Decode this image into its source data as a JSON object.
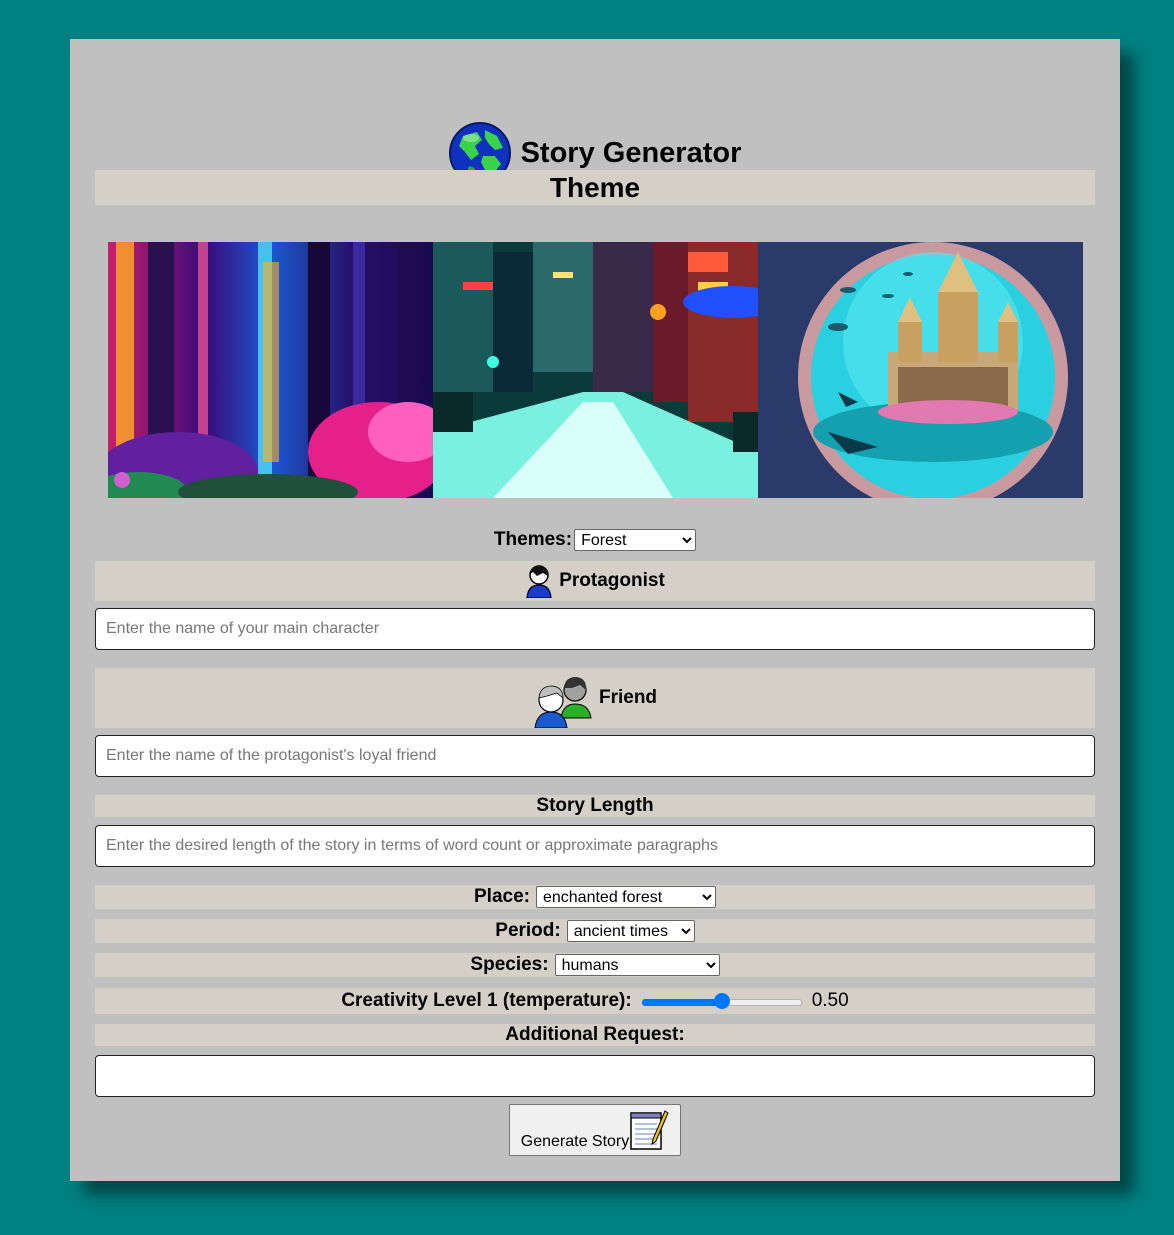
{
  "header": {
    "title": "Story Generator",
    "icon": "globe-icon"
  },
  "sections": {
    "theme_title": "Theme",
    "protagonist_title": "Protagonist",
    "friend_title": "Friend",
    "length_title": "Story Length",
    "additional_title": "Additional Request:"
  },
  "theme_images": [
    {
      "name": "forest"
    },
    {
      "name": "city"
    },
    {
      "name": "underwater"
    }
  ],
  "themes": {
    "label": "Themes:",
    "selected": "Forest"
  },
  "inputs": {
    "protagonist_placeholder": "Enter the name of your main character",
    "friend_placeholder": "Enter the name of the protagonist's loyal friend",
    "length_placeholder": "Enter the desired length of the story in terms of word count or approximate paragraphs",
    "additional_value": ""
  },
  "place": {
    "label": "Place:",
    "selected": "enchanted forest"
  },
  "period": {
    "label": "Period:",
    "selected": "ancient times"
  },
  "species": {
    "label": "Species:",
    "selected": "humans"
  },
  "creativity": {
    "label": "Creativity Level 1 (temperature):",
    "value": 0.5,
    "value_text": "0.50"
  },
  "generate_button": {
    "label": "Generate Story"
  },
  "colors": {
    "background": "#008080",
    "panel": "#c0c0c0",
    "band": "#d4d0c8",
    "accent": "#0075ff"
  }
}
